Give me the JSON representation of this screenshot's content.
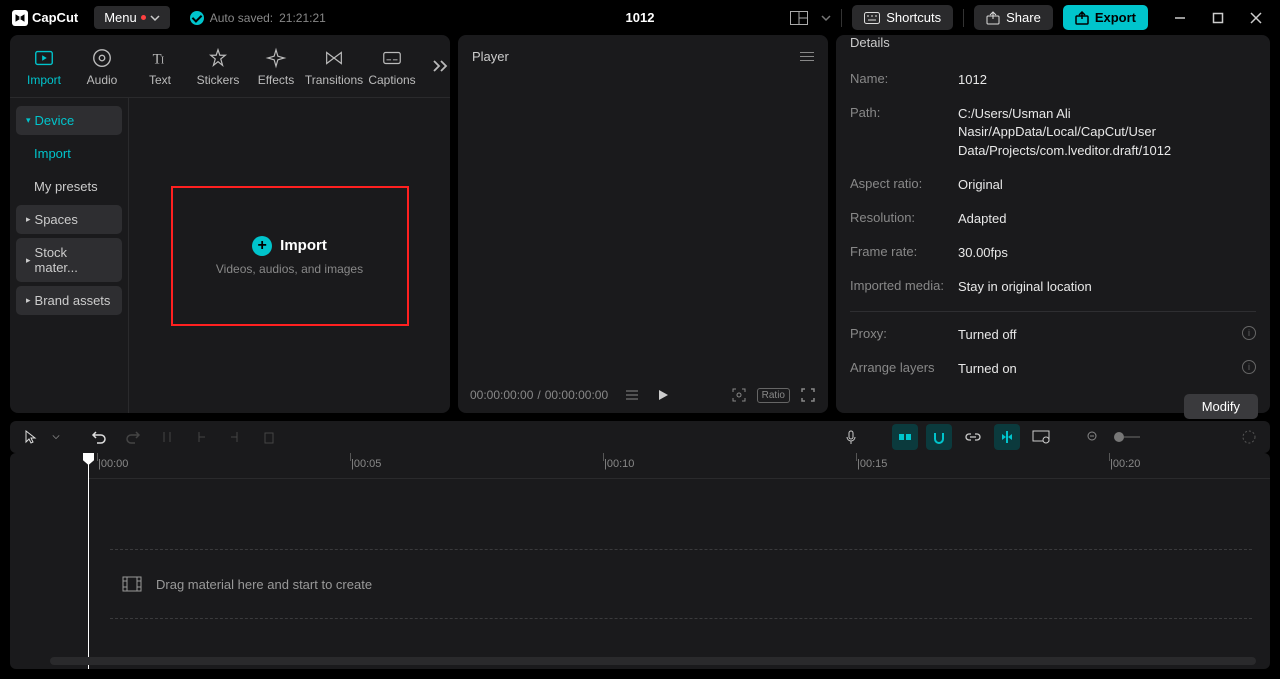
{
  "app": {
    "name": "CapCut",
    "menu_label": "Menu",
    "autosave_prefix": "Auto saved:",
    "autosave_time": "21:21:21",
    "project_title": "1012"
  },
  "titlebar": {
    "shortcuts": "Shortcuts",
    "share": "Share",
    "export": "Export"
  },
  "media_tabs": {
    "import": "Import",
    "audio": "Audio",
    "text": "Text",
    "stickers": "Stickers",
    "effects": "Effects",
    "transitions": "Transitions",
    "captions": "Captions"
  },
  "sidebar": {
    "device": "Device",
    "import": "Import",
    "my_presets": "My presets",
    "spaces": "Spaces",
    "stock": "Stock mater...",
    "brand": "Brand assets"
  },
  "import_zone": {
    "title": "Import",
    "subtitle": "Videos, audios, and images"
  },
  "player": {
    "title": "Player",
    "time_current": "00:00:00:00",
    "time_sep": " / ",
    "time_total": "00:00:00:00",
    "ratio": "Ratio"
  },
  "details": {
    "title": "Details",
    "name_label": "Name:",
    "name_val": "1012",
    "path_label": "Path:",
    "path_val": "C:/Users/Usman Ali Nasir/AppData/Local/CapCut/User Data/Projects/com.lveditor.draft/1012",
    "aspect_label": "Aspect ratio:",
    "aspect_val": "Original",
    "res_label": "Resolution:",
    "res_val": "Adapted",
    "fps_label": "Frame rate:",
    "fps_val": "30.00fps",
    "imported_label": "Imported media:",
    "imported_val": "Stay in original location",
    "proxy_label": "Proxy:",
    "proxy_val": "Turned off",
    "layers_label": "Arrange layers",
    "layers_val": "Turned on",
    "modify": "Modify"
  },
  "timeline": {
    "marks": [
      "00:00",
      "00:05",
      "00:10",
      "00:15",
      "00:20"
    ],
    "drop_hint": "Drag material here and start to create"
  }
}
